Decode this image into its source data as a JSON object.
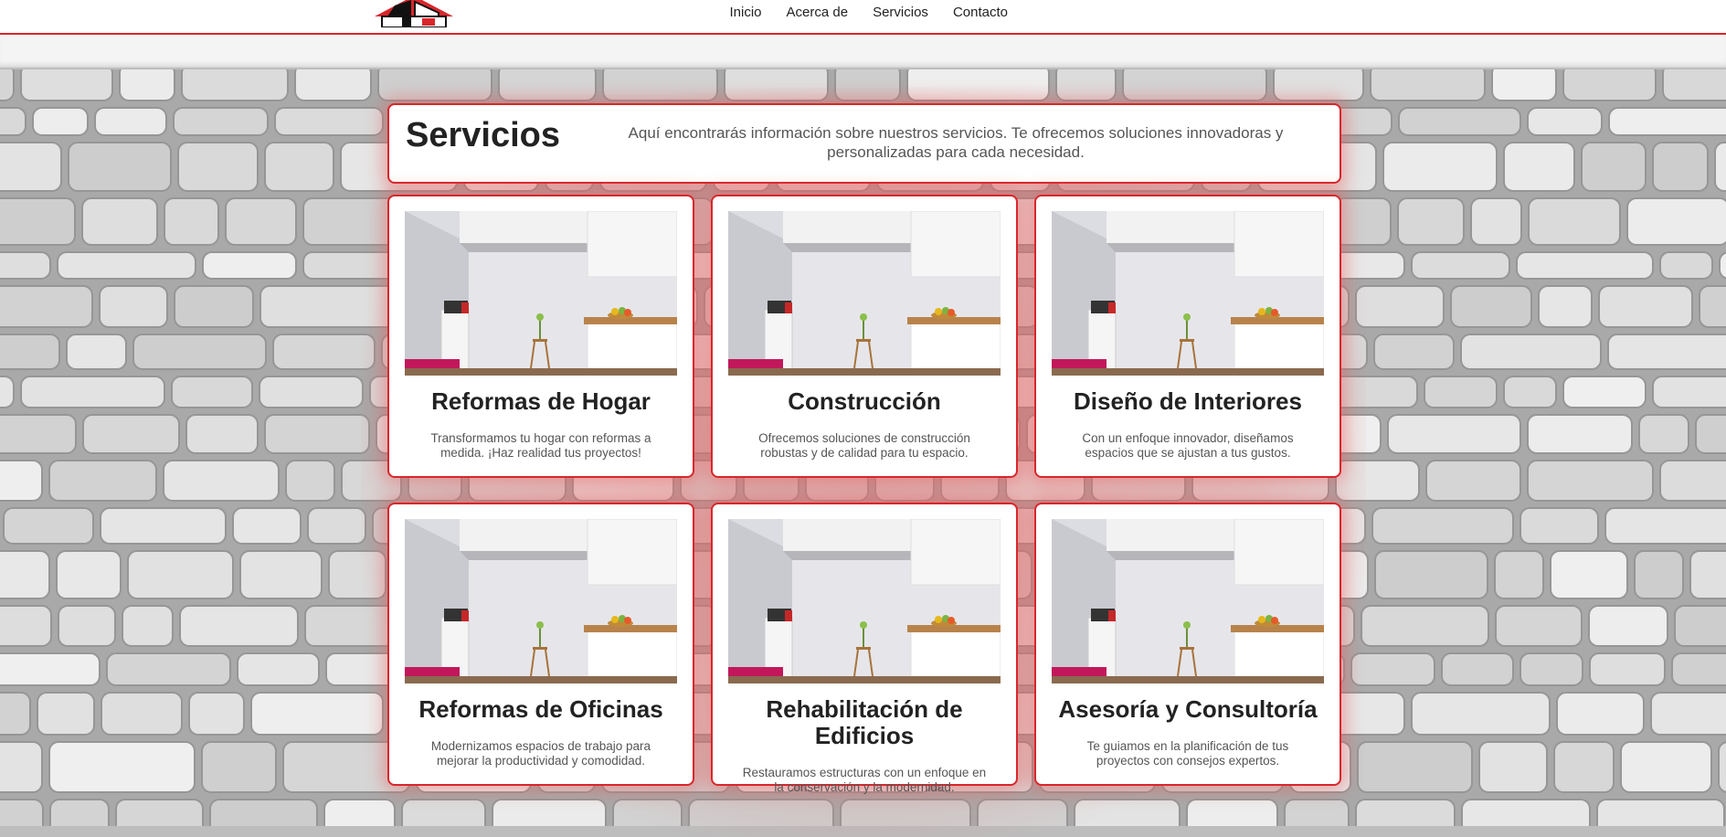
{
  "nav": {
    "items": [
      "Inicio",
      "Acerca de",
      "Servicios",
      "Contacto"
    ]
  },
  "intro": {
    "title": "Servicios",
    "description": "Aquí encontrarás información sobre nuestros servicios. Te ofrecemos soluciones innovadoras y personalizadas para cada necesidad."
  },
  "services": [
    {
      "title": "Reformas de Hogar",
      "description": "Transformamos tu hogar con reformas a medida. ¡Haz realidad tus proyectos!"
    },
    {
      "title": "Construcción",
      "description": "Ofrecemos soluciones de construcción robustas y de calidad para tu espacio."
    },
    {
      "title": "Diseño de Interiores",
      "description": "Con un enfoque innovador, diseñamos espacios que se ajustan a tus gustos."
    },
    {
      "title": "Reformas de Oficinas",
      "description": "Modernizamos espacios de trabajo para mejorar la productividad y comodidad."
    },
    {
      "title": "Rehabilitación de Edificios",
      "description": "Restauramos estructuras con un enfoque en la conservación y la modernidad."
    },
    {
      "title": "Asesoría y Consultoría",
      "description": "Te guiamos en la planificación de tus proyectos con consejos expertos."
    }
  ],
  "colors": {
    "accent": "#d9262b",
    "text": "#222222",
    "muted": "#555555",
    "card_bg": "#ffffff"
  },
  "icons": {
    "logo": "house-logo-icon"
  }
}
